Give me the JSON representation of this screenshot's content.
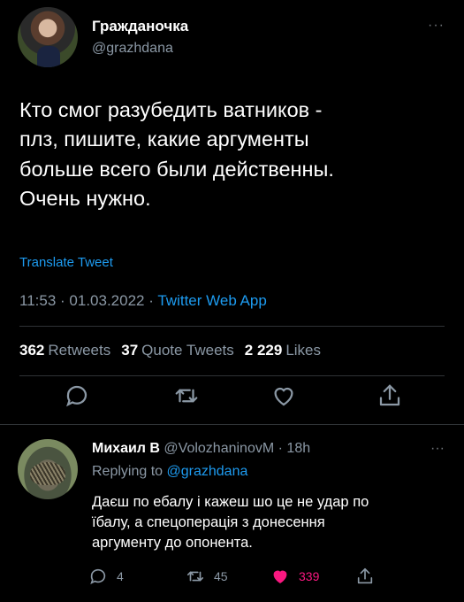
{
  "tweet": {
    "display_name": "Гражданочка",
    "handle": "@grazhdana",
    "more": "···",
    "text": "Кто смог разубедить ватников -\nплз, пишите, какие аргументы\nбольше всего были действенны.\nОчень нужно.",
    "translate": "Translate Tweet",
    "time": "11:53",
    "date": "01.03.2022",
    "sep": "·",
    "app": "Twitter Web App",
    "stats": {
      "retweets_count": "362",
      "retweets_label": "Retweets",
      "quotes_count": "37",
      "quotes_label": "Quote Tweets",
      "likes_count": "2 229",
      "likes_label": "Likes"
    }
  },
  "reply": {
    "name": "Михаил В",
    "handle": "@VolozhaninovM",
    "sep": "·",
    "age": "18h",
    "more": "···",
    "replying_label": "Replying to",
    "replying_to": "@grazhdana",
    "text": "Даєш по ебалу і кажеш шо це не удар по\nїбалу, а спецоперація з донесення\nаргументу до опонента.",
    "counts": {
      "replies": "4",
      "retweets": "45",
      "likes": "339"
    }
  },
  "icons": {
    "reply": "speech-bubble-icon",
    "retweet": "retweet-icon",
    "like": "heart-icon",
    "share": "share-icon"
  },
  "colors": {
    "accent": "#1d9bf0",
    "like": "#f91880",
    "muted": "#8b98a5",
    "background": "#000000"
  }
}
